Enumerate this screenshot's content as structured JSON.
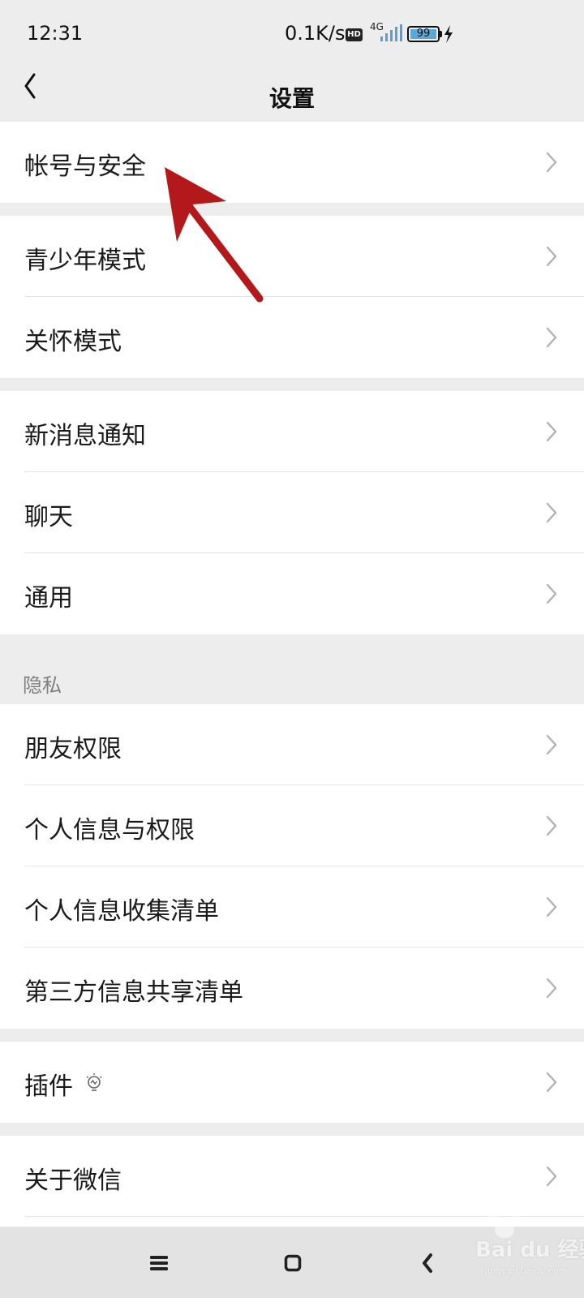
{
  "status_bar": {
    "time": "12:31",
    "net_speed": "0.1K/s",
    "hd_badge": "HD",
    "network_type": "4G",
    "battery_level": "99"
  },
  "header": {
    "title": "设置"
  },
  "groups": [
    {
      "items": [
        {
          "label": "帐号与安全"
        }
      ]
    },
    {
      "items": [
        {
          "label": "青少年模式"
        },
        {
          "label": "关怀模式"
        }
      ]
    },
    {
      "items": [
        {
          "label": "新消息通知"
        },
        {
          "label": "聊天"
        },
        {
          "label": "通用"
        }
      ]
    },
    {
      "section_title": "隐私",
      "items": [
        {
          "label": "朋友权限"
        },
        {
          "label": "个人信息与权限"
        },
        {
          "label": "个人信息收集清单"
        },
        {
          "label": "第三方信息共享清单"
        }
      ]
    },
    {
      "items": [
        {
          "label": "插件",
          "icon": "bulb-icon"
        }
      ]
    },
    {
      "items": [
        {
          "label": "关于微信"
        }
      ]
    }
  ],
  "annotation": {
    "arrow_color": "#b3191b"
  },
  "watermark": {
    "text": "Bai du 经验",
    "sub": "jingyan.baidu.com"
  },
  "colors": {
    "background": "#ededed",
    "card": "#ffffff",
    "secondary_text": "#7f7f7f"
  }
}
